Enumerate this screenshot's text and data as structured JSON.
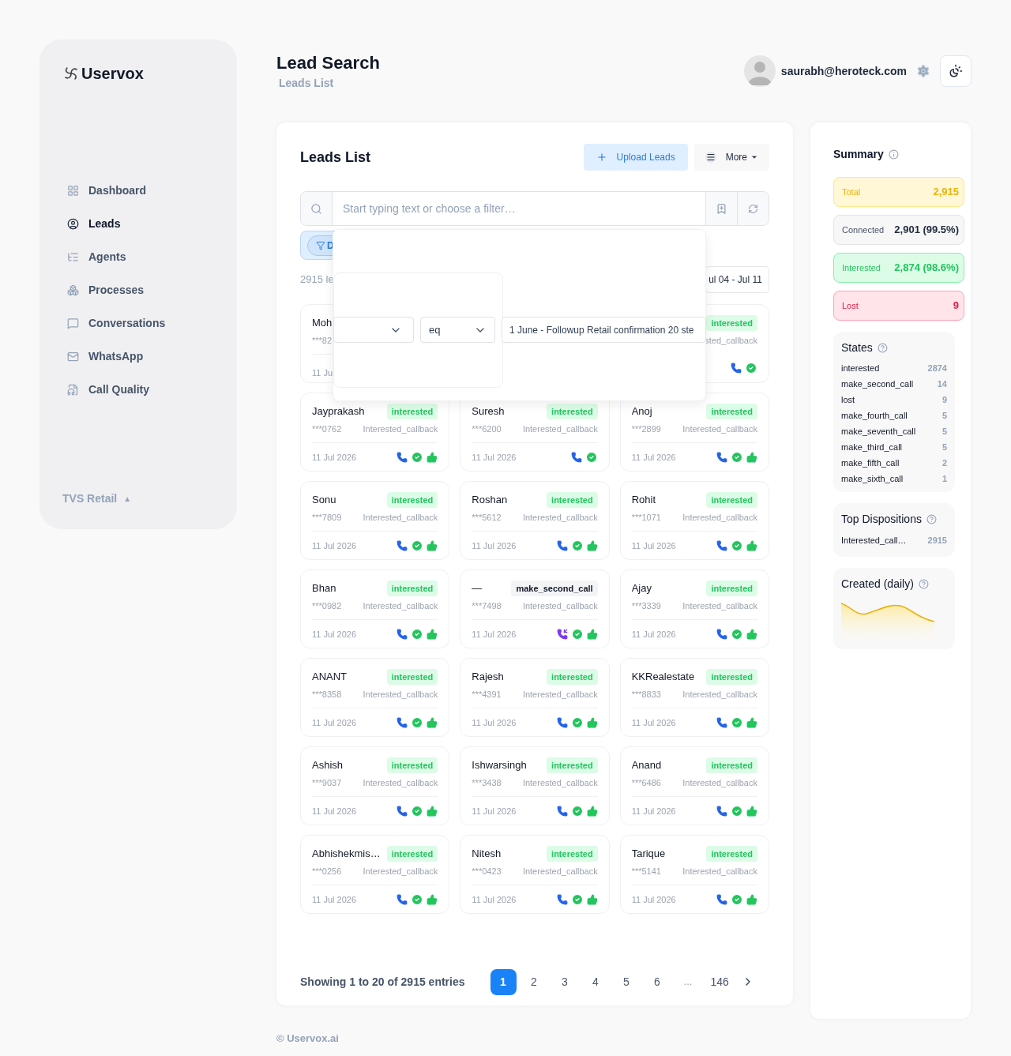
{
  "sidebar": {
    "logo": "Uservox",
    "items": [
      {
        "label": "Dashboard",
        "selected": false
      },
      {
        "label": "Leads",
        "selected": true
      },
      {
        "label": "Agents",
        "selected": false
      },
      {
        "label": "Processes",
        "selected": false
      },
      {
        "label": "Conversations",
        "selected": false
      },
      {
        "label": "WhatsApp",
        "selected": false
      },
      {
        "label": "Call Quality",
        "selected": false
      }
    ],
    "workspace": {
      "label": "TVS Retail",
      "caret": "▲"
    }
  },
  "header": {
    "title": "Lead Search",
    "subtitle": "Leads List",
    "user": "saurabh@heroteck.com"
  },
  "leads_panel": {
    "title": "Leads List",
    "upload_button": "Upload Leads",
    "more_button": "More",
    "search": {
      "placeholder": "Start typing text or choose a filter…"
    },
    "filter_chip": "D",
    "count_text": "2915 le",
    "date_range": "ul 04 - Jul 11",
    "filter_popup": {
      "operator": "eq",
      "value": "1 June - Followup Retail confirmation 20 ste"
    },
    "covered_cards": [
      {
        "kind": "cut_left",
        "name": "Moh",
        "phone": "***82",
        "date": "11 Ju"
      },
      {
        "kind": "cut_right",
        "state": "interested",
        "positive": true,
        "disposition": "sted_callback",
        "incoming": false,
        "connected": true,
        "liked": false
      }
    ],
    "cards": [
      {
        "name": "Jayprakash",
        "phone": "***0762",
        "state": "interested",
        "positive": true,
        "disposition": "Interested_callback",
        "date": "11 Jul 2026",
        "incoming": false,
        "connected": true,
        "liked": true
      },
      {
        "name": "Suresh",
        "phone": "***6200",
        "state": "interested",
        "positive": true,
        "disposition": "Interested_callback",
        "date": "11 Jul 2026",
        "incoming": false,
        "connected": true,
        "liked": false
      },
      {
        "name": "Anoj",
        "phone": "***2899",
        "state": "interested",
        "positive": true,
        "disposition": "Interested_callback",
        "date": "11 Jul 2026",
        "incoming": false,
        "connected": true,
        "liked": true
      },
      {
        "name": "Sonu",
        "phone": "***7809",
        "state": "interested",
        "positive": true,
        "disposition": "Interested_callback",
        "date": "11 Jul 2026",
        "incoming": false,
        "connected": true,
        "liked": true
      },
      {
        "name": "Roshan",
        "phone": "***5612",
        "state": "interested",
        "positive": true,
        "disposition": "Interested_callback",
        "date": "11 Jul 2026",
        "incoming": false,
        "connected": true,
        "liked": true
      },
      {
        "name": "Rohit",
        "phone": "***1071",
        "state": "interested",
        "positive": true,
        "disposition": "Interested_callback",
        "date": "11 Jul 2026",
        "incoming": false,
        "connected": true,
        "liked": true
      },
      {
        "name": "Bhan",
        "phone": "***0982",
        "state": "interested",
        "positive": true,
        "disposition": "Interested_callback",
        "date": "11 Jul 2026",
        "incoming": false,
        "connected": true,
        "liked": true
      },
      {
        "name": "—",
        "phone": "***7498",
        "state": "make_second_call",
        "positive": false,
        "disposition": "Interested_callback",
        "date": "11 Jul 2026",
        "incoming": true,
        "connected": true,
        "liked": true
      },
      {
        "name": "Ajay",
        "phone": "***3339",
        "state": "interested",
        "positive": true,
        "disposition": "Interested_callback",
        "date": "11 Jul 2026",
        "incoming": false,
        "connected": true,
        "liked": true
      },
      {
        "name": "ANANT",
        "phone": "***8358",
        "state": "interested",
        "positive": true,
        "disposition": "Interested_callback",
        "date": "11 Jul 2026",
        "incoming": false,
        "connected": true,
        "liked": true
      },
      {
        "name": "Rajesh",
        "phone": "***4391",
        "state": "interested",
        "positive": true,
        "disposition": "Interested_callback",
        "date": "11 Jul 2026",
        "incoming": false,
        "connected": true,
        "liked": true
      },
      {
        "name": "KKRealestate",
        "phone": "***8833",
        "state": "interested",
        "positive": true,
        "disposition": "Interested_callback",
        "date": "11 Jul 2026",
        "incoming": false,
        "connected": true,
        "liked": true
      },
      {
        "name": "Ashish",
        "phone": "***9037",
        "state": "interested",
        "positive": true,
        "disposition": "Interested_callback",
        "date": "11 Jul 2026",
        "incoming": false,
        "connected": true,
        "liked": true
      },
      {
        "name": "Ishwarsingh",
        "phone": "***3438",
        "state": "interested",
        "positive": true,
        "disposition": "Interested_callback",
        "date": "11 Jul 2026",
        "incoming": false,
        "connected": true,
        "liked": true
      },
      {
        "name": "Anand",
        "phone": "***6486",
        "state": "interested",
        "positive": true,
        "disposition": "Interested_callback",
        "date": "11 Jul 2026",
        "incoming": false,
        "connected": true,
        "liked": true
      },
      {
        "name": "Abhishekmis…",
        "phone": "***0256",
        "state": "interested",
        "positive": true,
        "disposition": "Interested_callback",
        "date": "11 Jul 2026",
        "incoming": false,
        "connected": true,
        "liked": true
      },
      {
        "name": "Nitesh",
        "phone": "***0423",
        "state": "interested",
        "positive": true,
        "disposition": "Interested_callback",
        "date": "11 Jul 2026",
        "incoming": false,
        "connected": true,
        "liked": true
      },
      {
        "name": "Tarique",
        "phone": "***5141",
        "state": "interested",
        "positive": true,
        "disposition": "Interested_callback",
        "date": "11 Jul 2026",
        "incoming": false,
        "connected": true,
        "liked": true
      }
    ],
    "pagination": {
      "summary": "Showing 1 to 20 of 2915 entries",
      "pages": [
        {
          "label": "1",
          "kind": "page",
          "selected": true
        },
        {
          "label": "2",
          "kind": "page",
          "selected": false
        },
        {
          "label": "3",
          "kind": "page",
          "selected": false
        },
        {
          "label": "4",
          "kind": "page",
          "selected": false
        },
        {
          "label": "5",
          "kind": "page",
          "selected": false
        },
        {
          "label": "6",
          "kind": "page",
          "selected": false
        },
        {
          "label": "...",
          "kind": "gap"
        },
        {
          "label": "146",
          "kind": "page",
          "selected": false
        }
      ]
    }
  },
  "summary": {
    "title": "Summary",
    "stats": [
      {
        "label": "Total",
        "value": "2,915",
        "kind": "total"
      },
      {
        "label": "Connected",
        "value": "2,901 (99.5%)",
        "kind": "connected"
      },
      {
        "label": "Interested",
        "value": "2,874 (98.6%)",
        "kind": "interested"
      },
      {
        "label": "Lost",
        "value": "9",
        "kind": "lost"
      }
    ],
    "states": {
      "title": "States",
      "items": [
        {
          "label": "interested",
          "count": "2874"
        },
        {
          "label": "make_second_call",
          "count": "14"
        },
        {
          "label": "lost",
          "count": "9"
        },
        {
          "label": "make_fourth_call",
          "count": "5"
        },
        {
          "label": "make_seventh_call",
          "count": "5"
        },
        {
          "label": "make_third_call",
          "count": "5"
        },
        {
          "label": "make_fifth_call",
          "count": "2"
        },
        {
          "label": "make_sixth_call",
          "count": "1"
        }
      ]
    },
    "dispositions": {
      "title": "Top Dispositions",
      "items": [
        {
          "label": "Interested_call…",
          "count": "2915"
        }
      ]
    },
    "created": {
      "title": "Created (daily)"
    }
  },
  "footer": "© Uservox.ai"
}
